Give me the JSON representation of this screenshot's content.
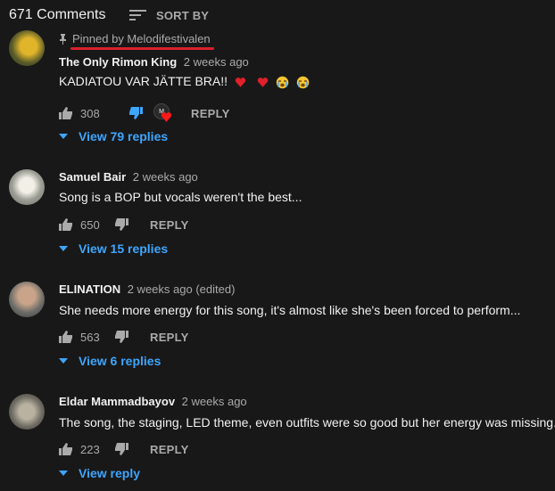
{
  "header": {
    "count_label": "671 Comments",
    "sort_label": "SORT BY"
  },
  "comments": [
    {
      "pinned_label": "Pinned by Melodifestivalen",
      "author": "The Only Rimon King",
      "time": "2 weeks ago",
      "text": "KADIATOU VAR JÄTTE BRA!!",
      "emojis": [
        "red-heart",
        "red-heart",
        "crying-face",
        "crying-face"
      ],
      "likes": "308",
      "disliked_active": true,
      "creator_heart": true,
      "reply_label": "REPLY",
      "replies_label": "View 79 replies"
    },
    {
      "author": "Samuel Bair",
      "time": "2 weeks ago",
      "text": "Song is a BOP but vocals weren't the best...",
      "likes": "650",
      "reply_label": "REPLY",
      "replies_label": "View 15 replies"
    },
    {
      "author": "ELINATION",
      "time": "2 weeks ago (edited)",
      "text": "She needs more energy for this song, it's almost like she's been forced to perform...",
      "likes": "563",
      "reply_label": "REPLY",
      "replies_label": "View 6 replies"
    },
    {
      "author": "Eldar Mammadbayov",
      "time": "2 weeks ago",
      "text": "The song, the staging, LED theme,  even outfits were so good but her energy was missing.",
      "likes": "223",
      "reply_label": "REPLY",
      "replies_label": "View reply"
    }
  ],
  "colors": {
    "background": "#181818",
    "link_blue": "#3ea6ff",
    "secondary_text": "#aaaaaa",
    "annotation_red": "#d8222b",
    "dislike_active": "#3ea6ff"
  }
}
